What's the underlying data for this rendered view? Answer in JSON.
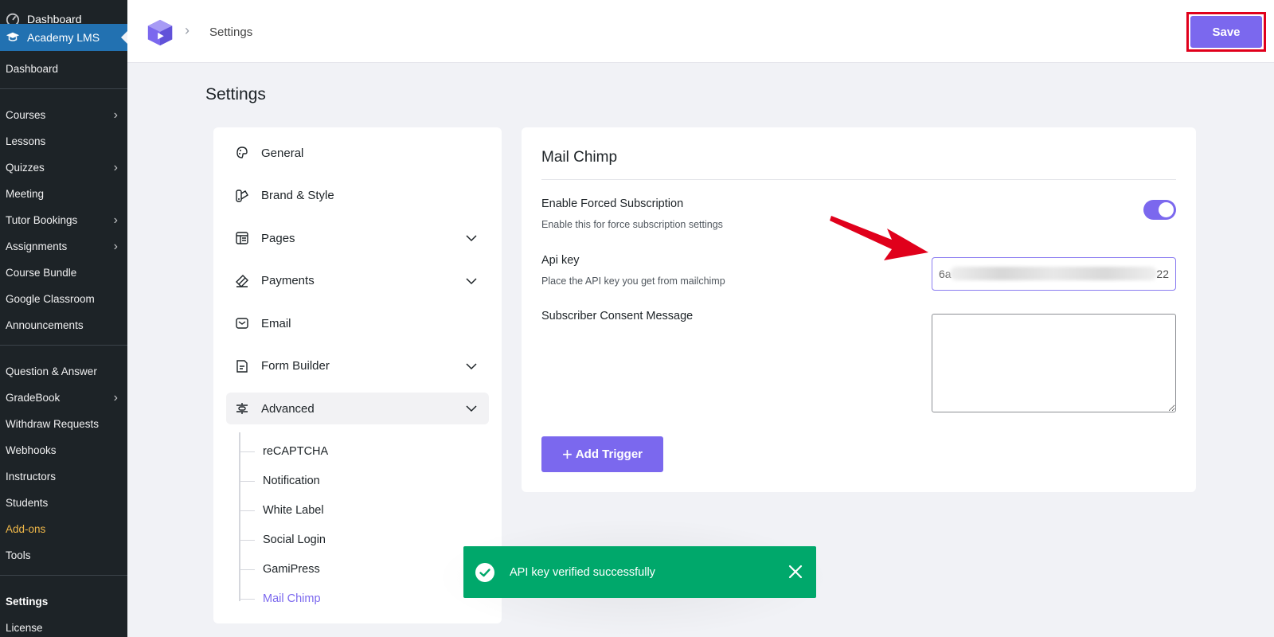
{
  "wp_sidebar": {
    "top_item": "Dashboard",
    "active_plugin": "Academy LMS",
    "items": [
      {
        "label": "Dashboard",
        "submenu": false
      },
      {
        "separator": true
      },
      {
        "label": "Courses",
        "submenu": true
      },
      {
        "label": "Lessons",
        "submenu": false
      },
      {
        "label": "Quizzes",
        "submenu": true
      },
      {
        "label": "Meeting",
        "submenu": false
      },
      {
        "label": "Tutor Bookings",
        "submenu": true
      },
      {
        "label": "Assignments",
        "submenu": true
      },
      {
        "label": "Course Bundle",
        "submenu": false
      },
      {
        "label": "Google Classroom",
        "submenu": false
      },
      {
        "label": "Announcements",
        "submenu": false
      },
      {
        "separator": true
      },
      {
        "label": "Question & Answer",
        "submenu": false
      },
      {
        "label": "GradeBook",
        "submenu": true
      },
      {
        "label": "Withdraw Requests",
        "submenu": false
      },
      {
        "label": "Webhooks",
        "submenu": false
      },
      {
        "label": "Instructors",
        "submenu": false
      },
      {
        "label": "Students",
        "submenu": false
      },
      {
        "label": "Add-ons",
        "submenu": false,
        "highlight": true
      },
      {
        "label": "Tools",
        "submenu": false
      },
      {
        "separator": true
      },
      {
        "label": "Settings",
        "submenu": false,
        "current": true
      },
      {
        "label": "License",
        "submenu": false
      }
    ]
  },
  "header": {
    "breadcrumb": "Settings",
    "save_label": "Save"
  },
  "page": {
    "title": "Settings"
  },
  "settings_nav": {
    "items": [
      {
        "label": "General",
        "icon": "general-icon",
        "expandable": false
      },
      {
        "label": "Brand & Style",
        "icon": "brand-style-icon",
        "expandable": false
      },
      {
        "label": "Pages",
        "icon": "pages-icon",
        "expandable": true
      },
      {
        "label": "Payments",
        "icon": "payments-icon",
        "expandable": true
      },
      {
        "label": "Email",
        "icon": "email-icon",
        "expandable": false
      },
      {
        "label": "Form Builder",
        "icon": "form-builder-icon",
        "expandable": true
      },
      {
        "label": "Advanced",
        "icon": "advanced-icon",
        "expandable": true,
        "active": true
      }
    ],
    "advanced_subitems": [
      "reCAPTCHA",
      "Notification",
      "White Label",
      "Social Login",
      "GamiPress",
      "Mail Chimp"
    ],
    "current_subitem": "Mail Chimp"
  },
  "mailchimp": {
    "title": "Mail Chimp",
    "forced_subscription": {
      "label": "Enable Forced Subscription",
      "hint": "Enable this for force subscription settings",
      "enabled": true
    },
    "api_key": {
      "label": "Api key",
      "hint": "Place the API key you get from mailchimp",
      "visible_start": "6a",
      "visible_end": "22"
    },
    "consent": {
      "label": "Subscriber Consent Message",
      "value": ""
    },
    "add_trigger_label": "Add Trigger"
  },
  "toast": {
    "message": "API key verified successfully"
  },
  "colors": {
    "accent": "#7b68ee",
    "wp_sidebar": "#1d2327",
    "wp_active": "#2271b1",
    "toast": "#00a86b",
    "annotation": "#e0001b"
  }
}
